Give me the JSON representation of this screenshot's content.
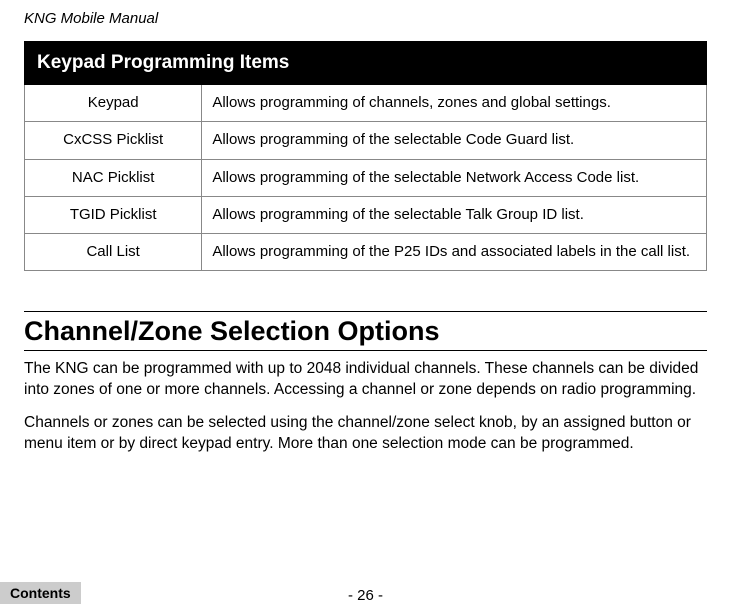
{
  "doc_title": "KNG Mobile Manual",
  "table": {
    "header": "Keypad Programming Items",
    "rows": [
      {
        "label": "Keypad",
        "desc": "Allows programming of channels, zones and global settings."
      },
      {
        "label": "CxCSS Picklist",
        "desc": "Allows programming of the selectable Code Guard list."
      },
      {
        "label": "NAC Picklist",
        "desc": "Allows programming of the selectable Network Access Code list."
      },
      {
        "label": "TGID Picklist",
        "desc": "Allows programming of the selectable Talk Group ID list."
      },
      {
        "label": "Call List",
        "desc": "Allows programming of the P25 IDs and associated labels in the call list."
      }
    ]
  },
  "section": {
    "heading": "Channel/Zone Selection Options",
    "p1": "The KNG can be programmed with up to 2048 individual channels. These channels can be divided into zones of one or more channels. Accessing a channel or zone depends on radio programming.",
    "p2": "Channels or zones can be selected using the channel/zone select knob, by an assigned button or menu item or by direct keypad entry. More than one selection mode can be programmed."
  },
  "footer": {
    "page": "- 26 -",
    "contents": "Contents"
  }
}
